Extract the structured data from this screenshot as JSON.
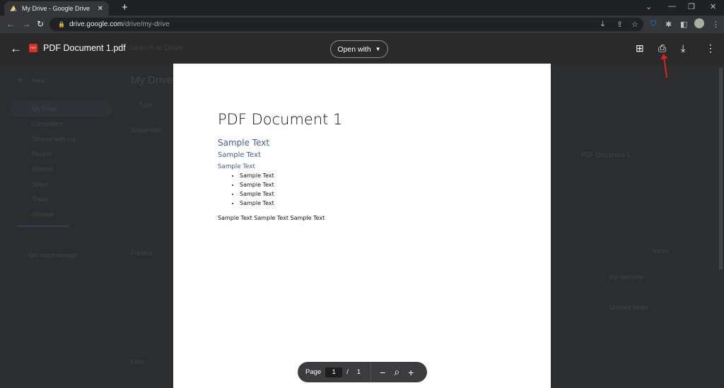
{
  "browser": {
    "tab_title": "My Drive - Google Drive",
    "url_host": "drive.google.com",
    "url_path": "/drive/my-drive"
  },
  "viewer": {
    "file_name": "PDF Document 1.pdf",
    "open_with": "Open with",
    "search_placeholder": "Search in Drive"
  },
  "drive": {
    "new": "New",
    "nav": [
      "My Drive",
      "Computers",
      "Shared with me",
      "Recent",
      "Starred",
      "Spam",
      "Trash",
      "Storage"
    ],
    "get_storage": "Get more storage",
    "title": "My Drive",
    "type_filter": "Type",
    "suggested": "Suggested",
    "folders": "Folders",
    "files": "Files",
    "sort": "Name",
    "suggested_file": "PDF Document 1",
    "folder_items": [
      "my samples",
      "Untitled folder"
    ]
  },
  "document": {
    "title": "PDF Document 1",
    "heading1": "Sample Text",
    "heading2": "Sample Text",
    "heading3": "Sample Text",
    "bullets": [
      "Sample Text",
      "Sample Text",
      "Sample Text",
      "Sample Text"
    ],
    "paragraph": "Sample Text Sample Text Sample Text"
  },
  "pager": {
    "label": "Page",
    "current": "1",
    "separator": "/",
    "total": "1"
  },
  "colors": {
    "annotation_arrow": "#e02020",
    "heading": "#3f5e9a"
  }
}
